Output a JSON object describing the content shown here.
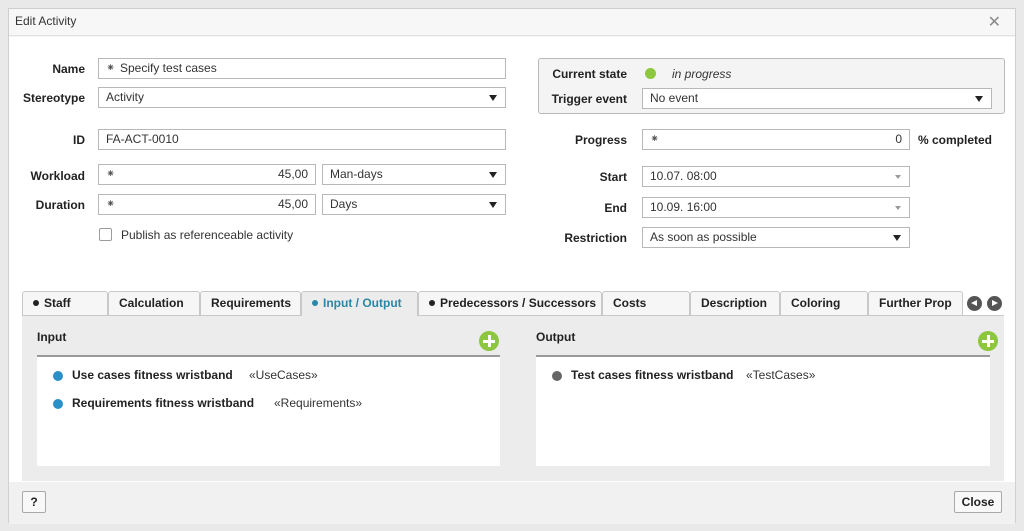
{
  "dialog": {
    "title": "Edit Activity",
    "close_icon": "close-icon"
  },
  "form": {
    "name_label": "Name",
    "name_value": "Specify test cases",
    "stereotype_label": "Stereotype",
    "stereotype_value": "Activity",
    "id_label": "ID",
    "id_value": "FA-ACT-0010",
    "workload_label": "Workload",
    "workload_value": "45,00",
    "workload_unit": "Man-days",
    "duration_label": "Duration",
    "duration_value": "45,00",
    "duration_unit": "Days",
    "publish_label": "Publish as referenceable activity",
    "publish_checked": false,
    "required_marker": "⁕"
  },
  "state": {
    "current_state_label": "Current state",
    "current_state_value": "in progress",
    "current_state_color": "#8dc63f",
    "trigger_label": "Trigger event",
    "trigger_value": "No event"
  },
  "schedule": {
    "progress_label": "Progress",
    "progress_value": "0",
    "progress_suffix": "% completed",
    "start_label": "Start",
    "start_value": "10.07.  08:00",
    "end_label": "End",
    "end_value": "10.09.  16:00",
    "restriction_label": "Restriction",
    "restriction_value": "As soon as possible"
  },
  "tabs": [
    {
      "label": "Staff",
      "bullet": true
    },
    {
      "label": "Calculation",
      "bullet": false
    },
    {
      "label": "Requirements",
      "bullet": false
    },
    {
      "label": "Input / Output",
      "bullet": true,
      "active": true
    },
    {
      "label": "Predecessors / Successors",
      "bullet": true
    },
    {
      "label": "Costs",
      "bullet": false
    },
    {
      "label": "Description",
      "bullet": false
    },
    {
      "label": "Coloring",
      "bullet": false
    },
    {
      "label": "Further Prop",
      "bullet": false
    }
  ],
  "io": {
    "input_title": "Input",
    "output_title": "Output",
    "inputs": [
      {
        "name": "Use cases fitness wristband",
        "stereotype": "«UseCases»",
        "color": "#2b8fc7"
      },
      {
        "name": "Requirements fitness wristband",
        "stereotype": "«Requirements»",
        "color": "#2b8fc7"
      }
    ],
    "outputs": [
      {
        "name": "Test cases fitness wristband",
        "stereotype": "«TestCases»",
        "color": "#666666"
      }
    ]
  },
  "footer": {
    "help_label": "?",
    "close_label": "Close"
  }
}
